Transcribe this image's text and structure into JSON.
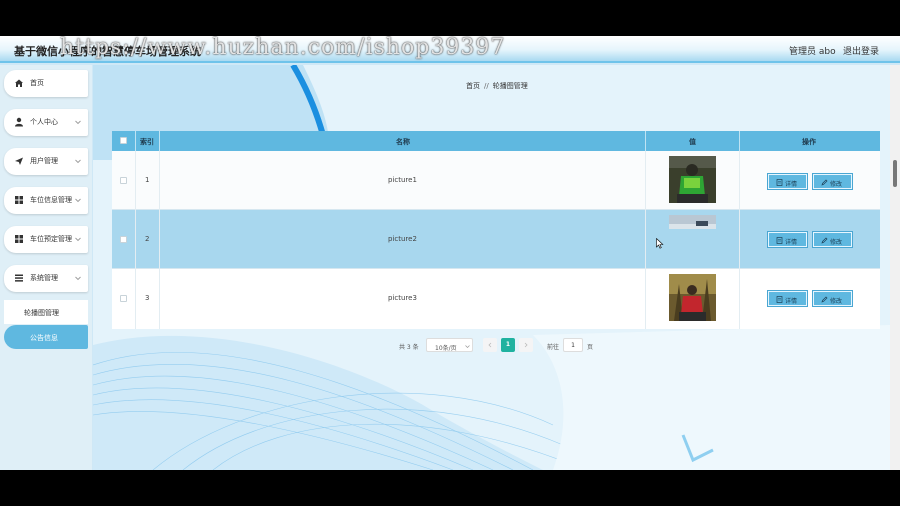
{
  "header": {
    "title": "基于微信小程序的智慧停车场管理系统",
    "watermark": "https://www.huzhan.com/ishop39397",
    "user": "管理员 abo",
    "logout": "退出登录"
  },
  "sidebar": {
    "items": [
      {
        "label": "首页",
        "icon": "home-icon"
      },
      {
        "label": "个人中心",
        "icon": "user-icon"
      },
      {
        "label": "用户管理",
        "icon": "send-icon"
      },
      {
        "label": "车位信息管理",
        "icon": "grid-icon"
      },
      {
        "label": "车位预定管理",
        "icon": "grid-icon"
      },
      {
        "label": "系统管理",
        "icon": "list-icon"
      }
    ],
    "subitems": [
      {
        "label": "轮播图管理"
      },
      {
        "label": "公告信息"
      }
    ]
  },
  "breadcrumb": {
    "home": "首页",
    "separator": "//",
    "current": "轮播图管理"
  },
  "table": {
    "columns": {
      "index": "索引",
      "name": "名称",
      "value": "值",
      "actions": "操作"
    },
    "rows": [
      {
        "index": "1",
        "name": "picture1"
      },
      {
        "index": "2",
        "name": "picture2"
      },
      {
        "index": "3",
        "name": "picture3"
      }
    ],
    "detail_label": "详情",
    "edit_label": "修改"
  },
  "pagination": {
    "total": "共 3 条",
    "page_size": "10条/页",
    "current_page": "1",
    "goto_label": "前往",
    "goto_value": "1",
    "goto_suffix": "页"
  },
  "colors": {
    "accent": "#5fb8e0",
    "header_border": "#6fc3ea",
    "active_page": "#1fb2a0",
    "row_highlight": "#a8d7ee"
  }
}
